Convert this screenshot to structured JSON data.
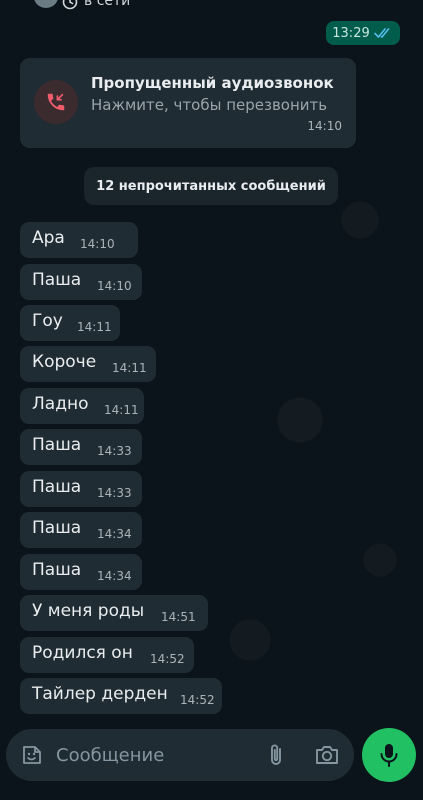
{
  "header": {
    "presence": "в сети"
  },
  "outgoing": {
    "time": "13:29"
  },
  "missed_call": {
    "title": "Пропущенный аудиозвонок",
    "subtitle": "Нажмите, чтобы перезвонить",
    "time": "14:10"
  },
  "unread_divider": "12 непрочитанных сообщений",
  "messages": [
    {
      "text": "Ара",
      "time": "14:10"
    },
    {
      "text": "Паша",
      "time": "14:10"
    },
    {
      "text": "Гоу",
      "time": "14:11"
    },
    {
      "text": "Короче",
      "time": "14:11"
    },
    {
      "text": "Ладно",
      "time": "14:11"
    },
    {
      "text": "Паша",
      "time": "14:33"
    },
    {
      "text": "Паша",
      "time": "14:33"
    },
    {
      "text": "Паша",
      "time": "14:34"
    },
    {
      "text": "Паша",
      "time": "14:34"
    },
    {
      "text": "У меня роды",
      "time": "14:51"
    },
    {
      "text": "Родился он",
      "time": "14:52"
    },
    {
      "text": "Тайлер дерден",
      "time": "14:52"
    }
  ],
  "composer": {
    "placeholder": "Сообщение"
  },
  "colors": {
    "background": "#0b141a",
    "incoming_bubble": "#202c33",
    "outgoing_bubble": "#005c4b",
    "accent_green": "#21c063",
    "missed_call_red": "#f15c6d",
    "read_ticks": "#53bdeb"
  },
  "icons": {
    "emoji": "sticker-smile-icon",
    "attach": "paperclip-icon",
    "camera": "camera-icon",
    "mic": "microphone-icon",
    "missed_call": "missed-call-icon",
    "read_status": "double-check-icon",
    "timer": "disappearing-timer-icon"
  }
}
